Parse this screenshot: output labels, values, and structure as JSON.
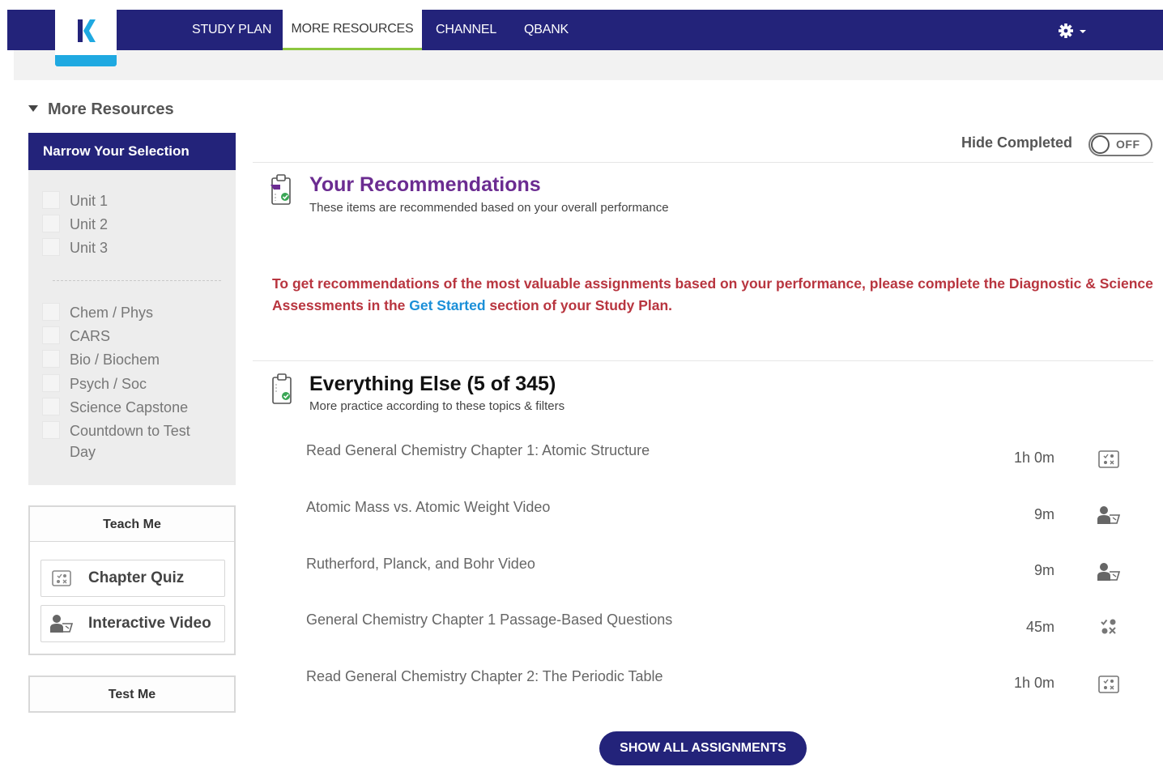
{
  "nav": {
    "items": [
      {
        "label": "STUDY PLAN"
      },
      {
        "label": "MORE RESOURCES"
      },
      {
        "label": "CHANNEL"
      },
      {
        "label": "QBANK"
      }
    ],
    "logo_icon": "kaplan-k-logo",
    "settings_icon": "gear-icon",
    "accent": "#23237a",
    "active_underline": "#8cc63f"
  },
  "sidebar": {
    "section_title": "More Resources",
    "filter_heading": "Narrow Your Selection",
    "units": [
      {
        "label": "Unit 1"
      },
      {
        "label": "Unit 2"
      },
      {
        "label": "Unit 3"
      }
    ],
    "subjects": [
      {
        "label": "Chem / Phys"
      },
      {
        "label": "CARS"
      },
      {
        "label": "Bio / Biochem"
      },
      {
        "label": "Psych / Soc"
      },
      {
        "label": "Science Capstone"
      },
      {
        "label": "Countdown to Test Day"
      }
    ],
    "teach_me": {
      "heading": "Teach Me",
      "buttons": [
        {
          "label": "Chapter Quiz",
          "icon": "quiz-icon"
        },
        {
          "label": "Interactive Video",
          "icon": "video-lesson-icon"
        }
      ]
    },
    "test_me": {
      "heading": "Test Me"
    }
  },
  "main": {
    "hide_completed": {
      "label": "Hide Completed",
      "state": "OFF"
    },
    "recommendations": {
      "title": "Your Recommendations",
      "subtitle": "These items are recommended based on your overall performance",
      "notice_before": "To get recommendations of the most valuable assignments based on your performance, please complete the Diagnostic & Science Assessments in the ",
      "notice_link": "Get Started",
      "notice_after": " section of your Study Plan."
    },
    "everything_else": {
      "title": "Everything Else (5 of 345)",
      "subtitle": "More practice according to these topics & filters",
      "rows": [
        {
          "title": "Read General Chemistry Chapter 1: Atomic Structure",
          "duration": "1h 0m",
          "icon": "reading-quiz-icon"
        },
        {
          "title": "Atomic Mass vs. Atomic Weight Video",
          "duration": "9m",
          "icon": "video-lesson-icon"
        },
        {
          "title": "Rutherford, Planck, and Bohr Video",
          "duration": "9m",
          "icon": "video-lesson-icon"
        },
        {
          "title": "General Chemistry Chapter 1 Passage-Based Questions",
          "duration": "45m",
          "icon": "practice-questions-icon"
        },
        {
          "title": "Read General Chemistry Chapter 2: The Periodic Table",
          "duration": "1h 0m",
          "icon": "reading-quiz-icon"
        }
      ]
    },
    "show_all_label": "SHOW ALL ASSIGNMENTS"
  },
  "colors": {
    "recommendation_title": "#6b2c91",
    "notice_text": "#b8353f",
    "link": "#1b8fd8"
  }
}
